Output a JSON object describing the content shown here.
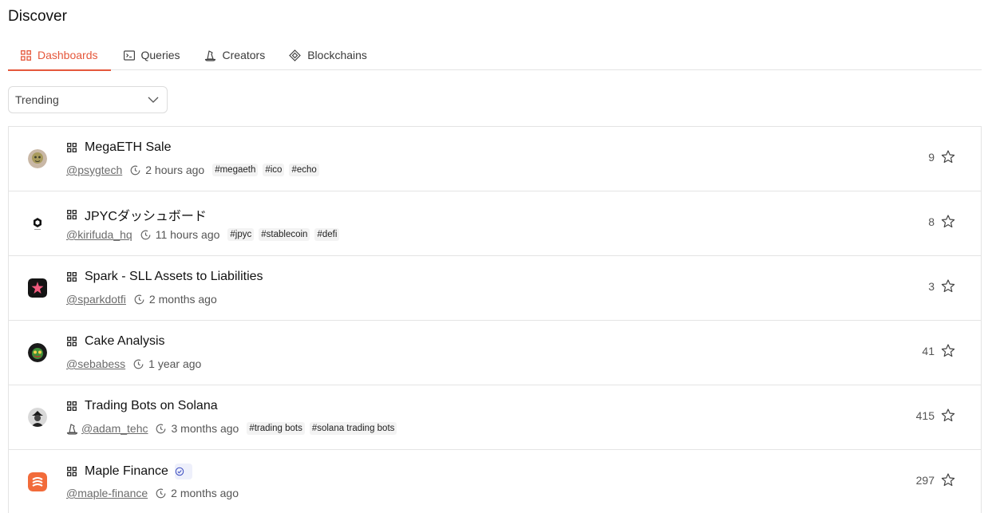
{
  "page": {
    "title": "Discover"
  },
  "tabs": [
    {
      "label": "Dashboards",
      "icon": "grid-icon",
      "active": true
    },
    {
      "label": "Queries",
      "icon": "terminal-icon",
      "active": false
    },
    {
      "label": "Creators",
      "icon": "wizard-hat-icon",
      "active": false
    },
    {
      "label": "Blockchains",
      "icon": "diamond-icon",
      "active": false
    }
  ],
  "sort": {
    "selected": "Trending"
  },
  "colors": {
    "accent": "#e5573b",
    "border": "#e4e4e4",
    "tag_bg": "#f3f3f3"
  },
  "dashboards": [
    {
      "title": "MegaETH Sale",
      "user": "@psygtech",
      "time": "2 hours ago",
      "tags": [
        "#megaeth",
        "#ico",
        "#echo"
      ],
      "stars": "9",
      "verified": false,
      "creator_badge": false
    },
    {
      "title": "JPYCダッシュボード",
      "user": "@kirifuda_hq",
      "time": "11 hours ago",
      "tags": [
        "#jpyc",
        "#stablecoin",
        "#defi"
      ],
      "stars": "8",
      "verified": false,
      "creator_badge": false
    },
    {
      "title": "Spark - SLL Assets to Liabilities",
      "user": "@sparkdotfi",
      "time": "2 months ago",
      "tags": [],
      "stars": "3",
      "verified": false,
      "creator_badge": false
    },
    {
      "title": "Cake Analysis",
      "user": "@sebabess",
      "time": "1 year ago",
      "tags": [],
      "stars": "41",
      "verified": false,
      "creator_badge": false
    },
    {
      "title": "Trading Bots on Solana",
      "user": "@adam_tehc",
      "time": "3 months ago",
      "tags": [
        "#trading bots",
        "#solana trading bots"
      ],
      "stars": "415",
      "verified": false,
      "creator_badge": true
    },
    {
      "title": "Maple Finance",
      "user": "@maple-finance",
      "time": "2 months ago",
      "tags": [],
      "stars": "297",
      "verified": true,
      "creator_badge": false
    }
  ]
}
